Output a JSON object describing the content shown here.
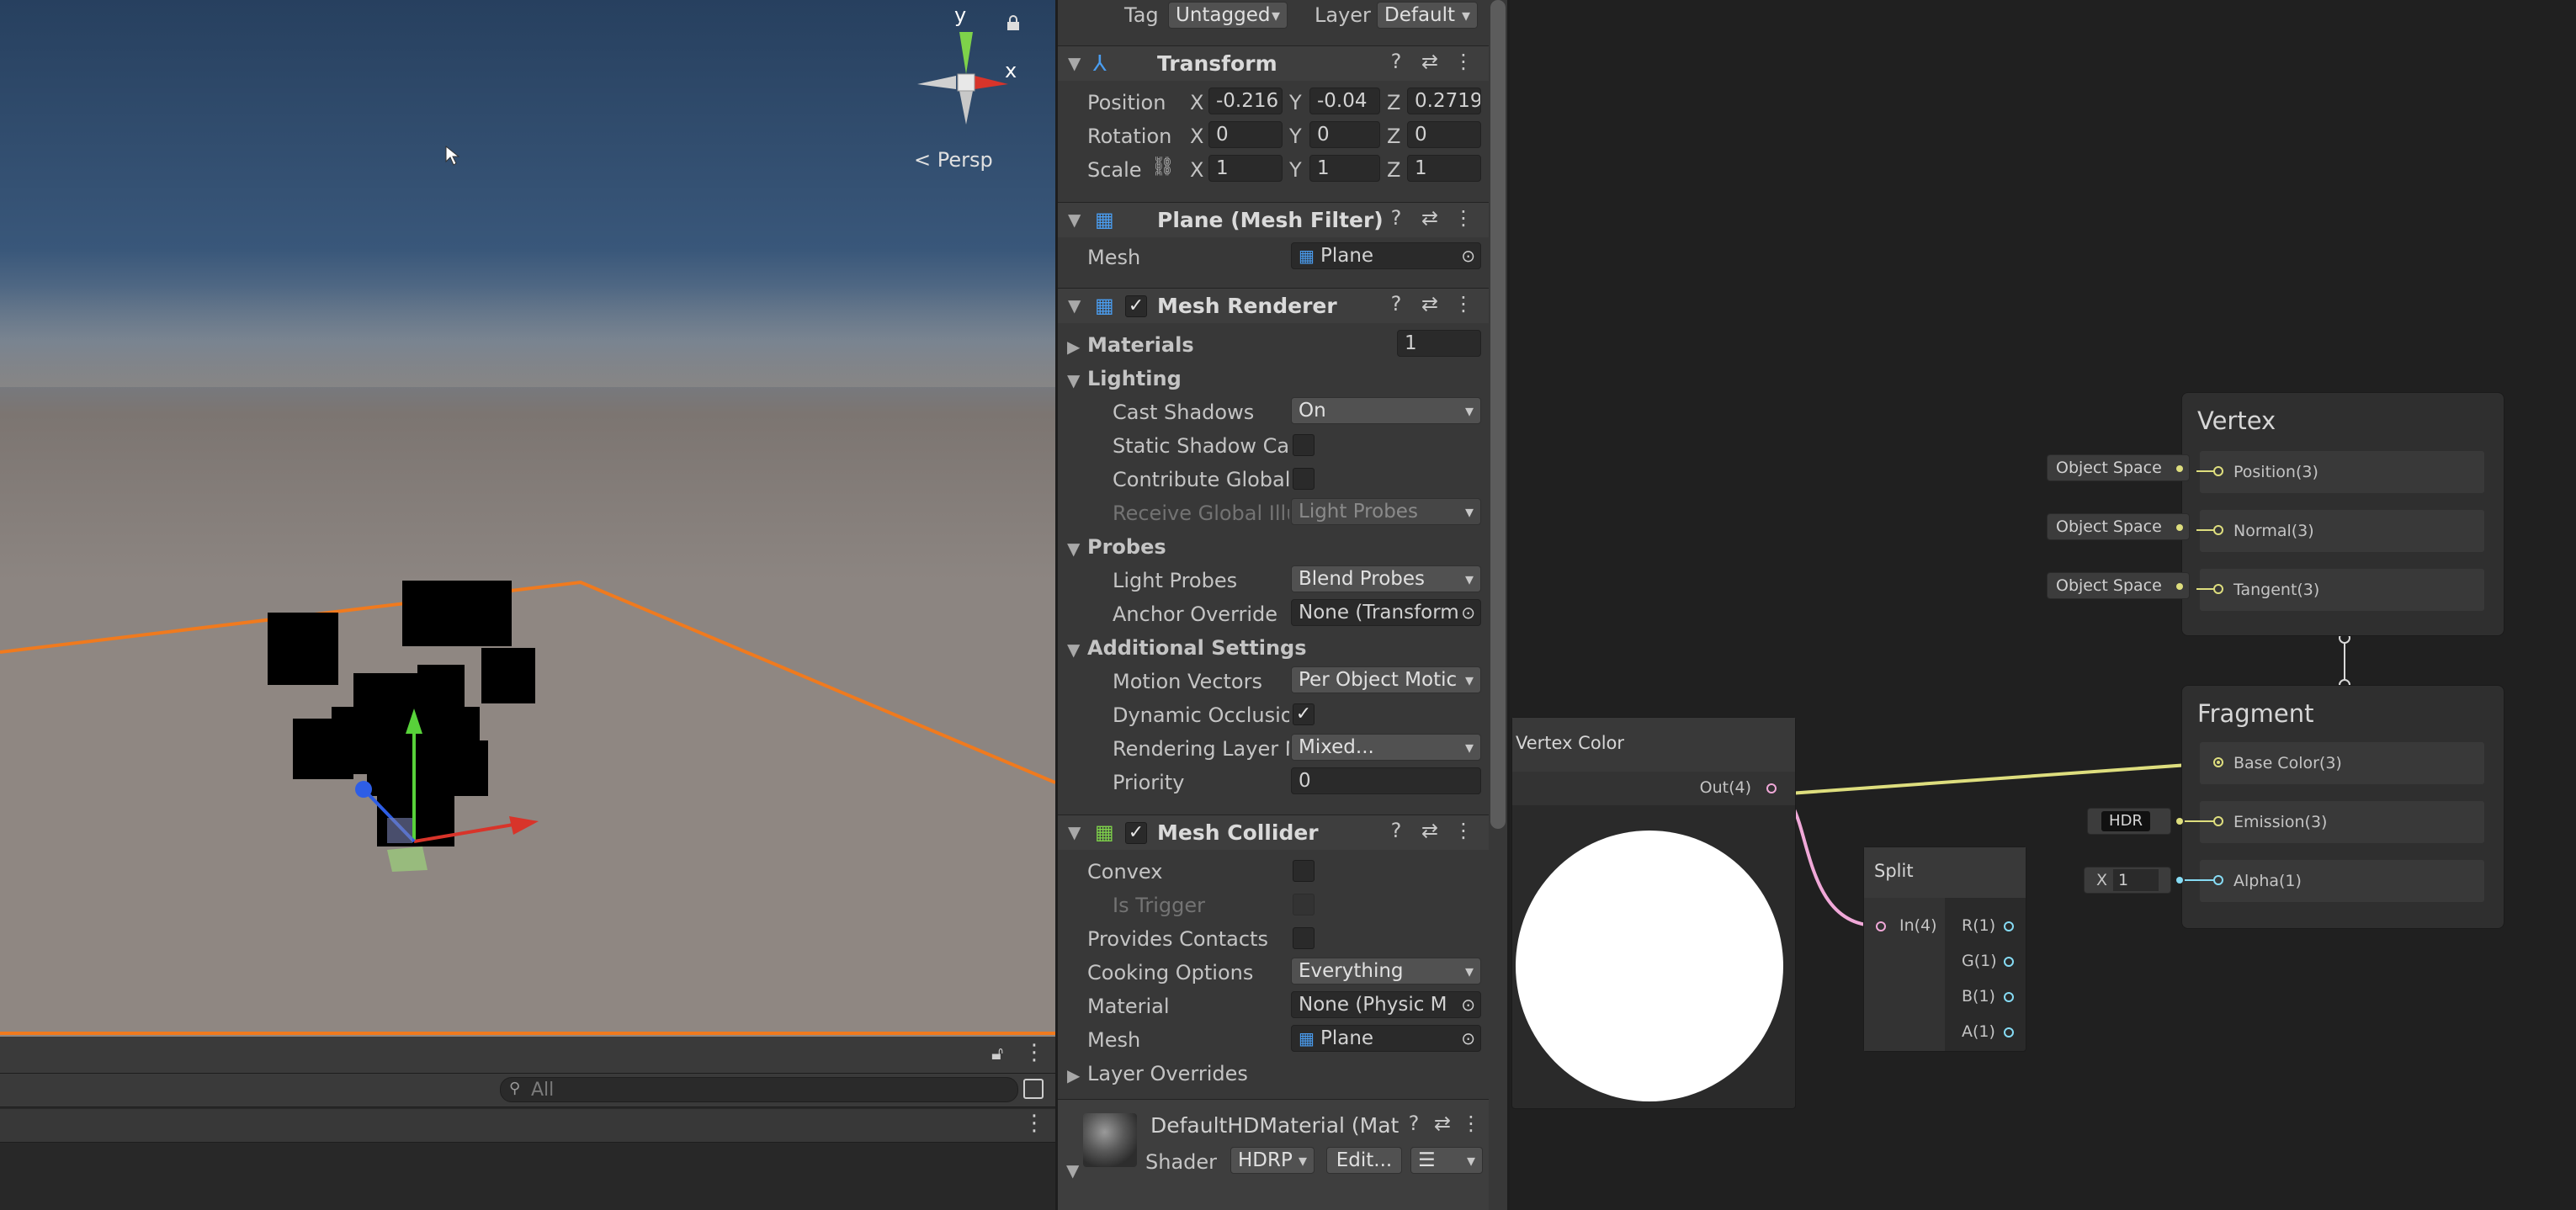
{
  "scene": {
    "gizmo": {
      "y": "y",
      "x": "x",
      "mode": "Persp"
    },
    "search_placeholder": "All"
  },
  "inspector": {
    "header": {
      "tag_label": "Tag",
      "tag_value": "Untagged",
      "layer_label": "Layer",
      "layer_value": "Default"
    },
    "transform": {
      "title": "Transform",
      "position": {
        "label": "Position",
        "x": "-0.216",
        "y": "-0.04",
        "z": "0.2719"
      },
      "rotation": {
        "label": "Rotation",
        "x": "0",
        "y": "0",
        "z": "0"
      },
      "scale": {
        "label": "Scale",
        "x": "1",
        "y": "1",
        "z": "1"
      },
      "axes": {
        "x": "X",
        "y": "Y",
        "z": "Z"
      }
    },
    "mesh_filter": {
      "title": "Plane (Mesh Filter)",
      "mesh_label": "Mesh",
      "mesh_value": "Plane"
    },
    "mesh_renderer": {
      "title": "Mesh Renderer",
      "materials_label": "Materials",
      "materials_count": "1",
      "lighting": "Lighting",
      "cast_shadows_label": "Cast Shadows",
      "cast_shadows_value": "On",
      "static_shadow_label": "Static Shadow Cas",
      "contribute_gi_label": "Contribute Global I",
      "receive_gi_label": "Receive Global Illu",
      "receive_gi_value": "Light Probes",
      "probes": "Probes",
      "light_probes_label": "Light Probes",
      "light_probes_value": "Blend Probes",
      "anchor_label": "Anchor Override",
      "anchor_value": "None (Transform",
      "additional": "Additional Settings",
      "motion_label": "Motion Vectors",
      "motion_value": "Per Object Motic",
      "dyn_occl_label": "Dynamic Occlusio",
      "rendering_layer_label": "Rendering Layer M",
      "rendering_layer_value": "Mixed...",
      "priority_label": "Priority",
      "priority_value": "0"
    },
    "mesh_collider": {
      "title": "Mesh Collider",
      "convex_label": "Convex",
      "is_trigger_label": "Is Trigger",
      "provides_contacts_label": "Provides Contacts",
      "cooking_label": "Cooking Options",
      "cooking_value": "Everything",
      "material_label": "Material",
      "material_value": "None (Physic M",
      "mesh_label": "Mesh",
      "mesh_value": "Plane",
      "layer_overrides": "Layer Overrides"
    },
    "material": {
      "title": "DefaultHDMaterial (Mat",
      "shader_label": "Shader",
      "shader_value": "HDRP",
      "edit_label": "Edit..."
    }
  },
  "graph": {
    "vertex": {
      "title": "Vertex",
      "slots": [
        {
          "label": "Position(3)",
          "input": "Object Space"
        },
        {
          "label": "Normal(3)",
          "input": "Object Space"
        },
        {
          "label": "Tangent(3)",
          "input": "Object Space"
        }
      ]
    },
    "fragment": {
      "title": "Fragment",
      "base_color": "Base Color(3)",
      "emission": "Emission(3)",
      "emission_input": "HDR",
      "alpha": "Alpha(1)",
      "alpha_axis": "X",
      "alpha_value": "1"
    },
    "vertex_color": {
      "title": "Vertex Color",
      "out": "Out(4)"
    },
    "split": {
      "title": "Split",
      "in": "In(4)",
      "outs": [
        "R(1)",
        "G(1)",
        "B(1)",
        "A(1)"
      ]
    },
    "colors": {
      "yellow": "#dede7e",
      "pink": "#f0a8d8",
      "cyan": "#86dbf4"
    }
  }
}
